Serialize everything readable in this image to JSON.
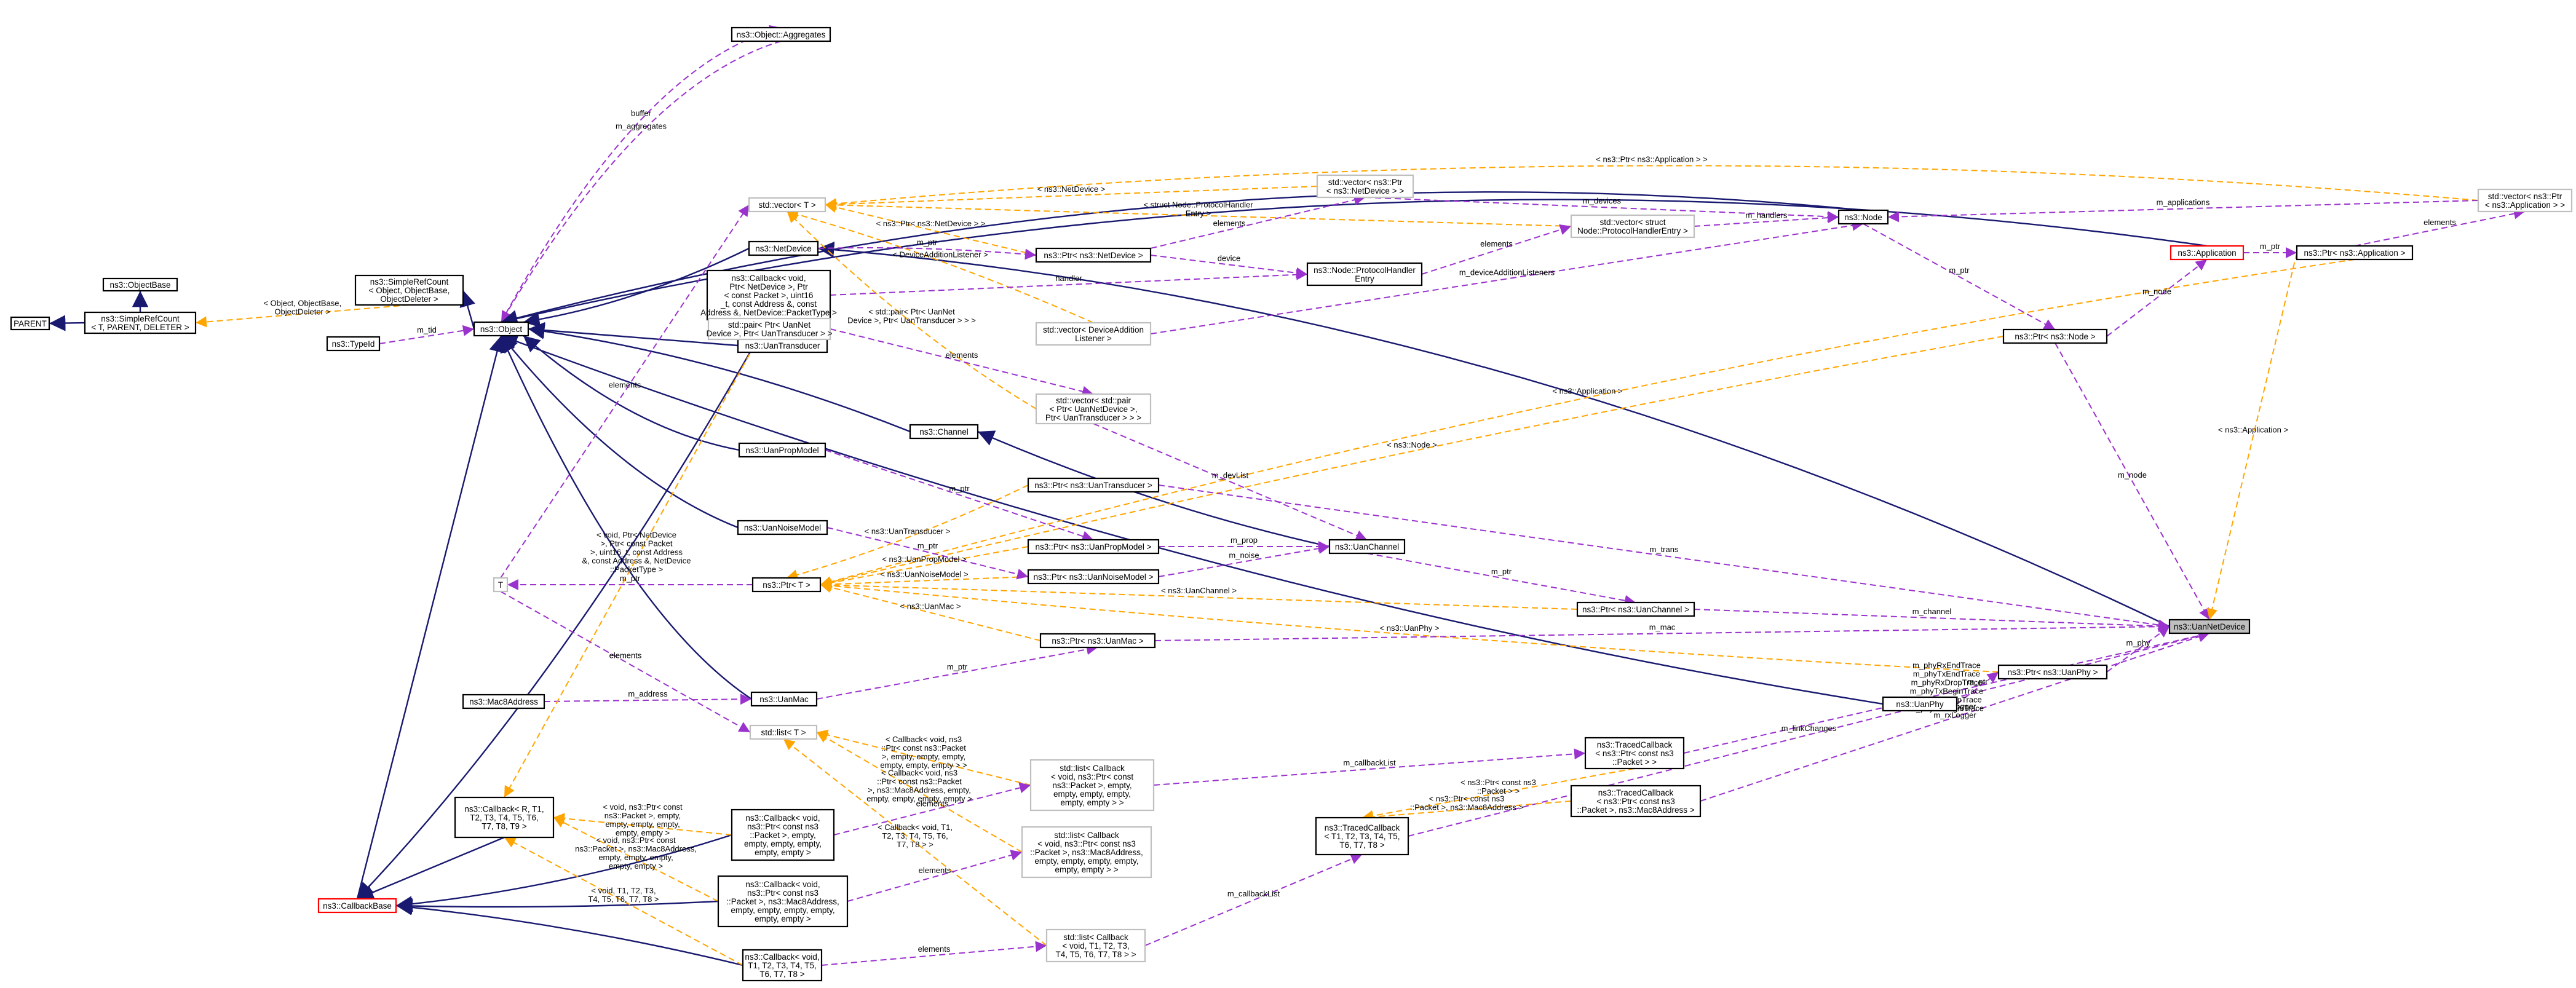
{
  "nodes": {
    "parent": "PARENT",
    "objectbase": "ns3::ObjectBase",
    "srcount_t": [
      "ns3::SimpleRefCount",
      "< T, PARENT, DELETER >"
    ],
    "srcount_obj": [
      "ns3::SimpleRefCount",
      "< Object, ObjectBase,",
      "ObjectDeleter >"
    ],
    "object": "ns3::Object",
    "typeid": "ns3::TypeId",
    "aggregates": "ns3::Object::Aggregates",
    "netdevice": "ns3::NetDevice",
    "cb_rx": [
      "ns3::Callback< void,",
      "Ptr< NetDevice >, Ptr",
      "< const Packet >, uint16",
      "_t, const Address &, const",
      "Address &, NetDevice::PacketType >"
    ],
    "uantransducer": "ns3::UanTransducer",
    "uanchannel_cls": "ns3::Channel",
    "uanprop": "ns3::UanPropModel",
    "uannoise": "ns3::UanNoiseModel",
    "t": "T",
    "ptr_t": "ns3::Ptr< T >",
    "uanmac": "ns3::UanMac",
    "macaddr": "ns3::Mac8Address",
    "list_t": "std::list< T >",
    "vector_t": "std::vector< T >",
    "ptr_netdev": "ns3::Ptr< ns3::NetDevice >",
    "vec_ptr_netdev": [
      "std::vector< ns3::Ptr",
      "< ns3::NetDevice > >"
    ],
    "vec_handler": [
      "std::vector< struct",
      "Node::ProtocolHandlerEntry >"
    ],
    "handler_entry": [
      "ns3::Node::ProtocolHandler",
      "Entry"
    ],
    "vec_listener": [
      "std::vector< DeviceAddition",
      "Listener >"
    ],
    "pair_dev": [
      "std::pair< Ptr< UanNet",
      "Device >, Ptr< UanTransducer > >"
    ],
    "vec_pair": [
      "std::vector< std::pair",
      "< Ptr< UanNetDevice >,",
      "Ptr< UanTransducer > > >"
    ],
    "ptr_transducer": "ns3::Ptr< ns3::UanTransducer >",
    "ptr_prop": "ns3::Ptr< ns3::UanPropModel >",
    "ptr_noise": "ns3::Ptr< ns3::UanNoiseModel >",
    "uanchannel": "ns3::UanChannel",
    "ptr_uanchannel": "ns3::Ptr< ns3::UanChannel >",
    "ptr_uanmac": "ns3::Ptr< ns3::UanMac >",
    "node": "ns3::Node",
    "application": "ns3::Application",
    "ptr_app": "ns3::Ptr< ns3::Application >",
    "vec_ptr_app": [
      "std::vector< ns3::Ptr",
      "< ns3::Application > >"
    ],
    "ptr_node": "ns3::Ptr< ns3::Node >",
    "uannetdevice": "ns3::UanNetDevice",
    "ptr_uanphy": "ns3::Ptr< ns3::UanPhy >",
    "uanphy": "ns3::UanPhy",
    "traced_pkt": [
      "ns3::TracedCallback",
      "< ns3::Ptr< const ns3",
      "::Packet > >"
    ],
    "traced_pkt_mac": [
      "ns3::TracedCallback",
      "< ns3::Ptr< const ns3",
      "::Packet >, ns3::Mac8Address >"
    ],
    "traced_t": [
      "ns3::TracedCallback",
      "< T1, T2, T3, T4, T5,",
      "T6, T7, T8 >"
    ],
    "cb_r": [
      "ns3::Callback< R, T1,",
      "T2, T3, T4, T5, T6,",
      "T7, T8, T9 >"
    ],
    "callbackbase": "ns3::CallbackBase",
    "list_cb_pkt": [
      "std::list< Callback",
      "< void, ns3::Ptr< const",
      "ns3::Packet >, empty,",
      "empty, empty, empty,",
      "empty, empty > >"
    ],
    "list_cb_mac": [
      "std::list< Callback",
      "< void, ns3::Ptr< const ns3",
      "::Packet >, ns3::Mac8Address,",
      "empty, empty, empty, empty,",
      "empty, empty > >"
    ],
    "list_cb_t": [
      "std::list< Callback",
      "< void, T1, T2, T3,",
      "T4, T5, T6, T7, T8 > >"
    ],
    "cb_void_pkt": [
      "ns3::Callback< void,",
      "ns3::Ptr< const ns3",
      "::Packet >, empty,",
      "empty, empty, empty,",
      "empty, empty >"
    ],
    "cb_void_mac": [
      "ns3::Callback< void,",
      "ns3::Ptr< const ns3",
      "::Packet >, ns3::Mac8Address,",
      "empty, empty, empty, empty,",
      "empty, empty >"
    ],
    "cb_void_t": [
      "ns3::Callback< void,",
      "T1, T2, T3, T4, T5,",
      "T6, T7, T8 >"
    ]
  },
  "edge_labels": {
    "buffer": "buffer",
    "m_aggregates": "m_aggregates",
    "m_tid": "m_tid",
    "elements_vec": "elements",
    "srcount_tpl": [
      "< Object, ObjectBase,",
      "ObjectDeleter >"
    ],
    "cb_rx_tpl": [
      "< void, Ptr< NetDevice",
      ">, Ptr< const Packet",
      ">, uint16_t, const Address",
      "&, const Address &, NetDevice",
      "::PacketType >"
    ],
    "elements_prop": "elements",
    "m_ptr_netdev": "m_ptr",
    "ptr_netdev_tpl": "< ns3::Ptr< ns3::NetDevice > >",
    "handler_tpl": [
      "< struct Node::ProtocolHandler",
      "Entry >"
    ],
    "listener_tpl": "< DeviceAdditionListener >",
    "netdev_tpl": "< ns3::NetDevice >",
    "pair_tpl": [
      "< std::pair< Ptr< UanNet",
      "Device >, Ptr< UanTransducer > > >"
    ],
    "elements_netdev": "elements",
    "device": "device",
    "handler": "handler",
    "elements_handler": "elements",
    "m_ptr_trans": "m_ptr",
    "m_devList": "m_devList",
    "transducer_tpl": "< ns3::UanTransducer >",
    "m_ptr_prop": "m_ptr",
    "m_prop": "m_prop",
    "prop_tpl": "< ns3::UanPropModel >",
    "m_ptr_noise": "m_ptr",
    "m_noise": "m_noise",
    "noise_tpl": "< ns3::UanNoiseModel >",
    "m_ptr_chan": "m_ptr",
    "chan_tpl": "< ns3::UanChannel >",
    "m_ptr_t": "m_ptr",
    "mac_tpl": "< ns3::UanMac >",
    "m_ptr_mac": "m_ptr",
    "m_address": "m_address",
    "phy_tpl": "< ns3::UanPhy >",
    "elements_list": "elements",
    "m_devices": "m_devices",
    "m_handlers": "m_handlers",
    "m_deviceAdditionListeners": "m_deviceAdditionListeners",
    "m_applications": "m_applications",
    "app_vec_tpl": "< ns3::Ptr< ns3::Application > >",
    "elements_app": "elements",
    "m_ptr_app": "m_ptr",
    "m_node_app": "m_node",
    "m_ptr_node": "m_ptr",
    "node_tpl": "< ns3::Node >",
    "m_node_dev": "m_node",
    "m_trans": "m_trans",
    "m_channel": "m_channel",
    "m_mac": "m_mac",
    "m_phy": "m_phy",
    "m_ptr_phy": "m_ptr",
    "phy_traces": [
      "m_phyRxEndTrace",
      "m_phyTxEndTrace",
      "m_phyRxDropTrace",
      "m_phyTxBeginTrace",
      "m_phyTxDropTrace",
      "m_phyRxBeginTrace"
    ],
    "loggers": [
      "m_txLogger",
      "m_rxLogger"
    ],
    "m_linkChanges": "m_linkChanges",
    "app_tpl": "< ns3::Application >",
    "m_callbackList_pkt": "m_callbackList",
    "m_callbackList_t": "m_callbackList",
    "traced_pkt_tpl": [
      "< ns3::Ptr< const ns3",
      "::Packet > >"
    ],
    "traced_mac_tpl": [
      "< ns3::Ptr< const ns3",
      "::Packet >, ns3::Mac8Address >"
    ],
    "list_pkt_tpl": [
      "< Callback< void, ns3",
      "::Ptr< const ns3::Packet",
      ">, empty, empty, empty,",
      "empty, empty, empty > >"
    ],
    "list_mac_tpl": [
      "< Callback< void, ns3",
      "::Ptr< const ns3::Packet",
      ">, ns3::Mac8Address, empty,",
      "empty, empty, empty, empty >"
    ],
    "list_t_tpl": [
      "< Callback< void, T1,",
      "T2, T3, T4, T5, T6,",
      "T7, T8 > >"
    ],
    "elements_cb1": "elements",
    "elements_cb2": "elements",
    "elements_cb3": "elements",
    "cb_pkt_tpl": [
      "< void, ns3::Ptr< const",
      "ns3::Packet >, empty,",
      "empty, empty, empty,",
      "empty, empty >"
    ],
    "cb_mac_tpl": [
      "< void, ns3::Ptr< const",
      "ns3::Packet >, ns3::Mac8Address,",
      "empty, empty, empty,",
      "empty, empty >"
    ],
    "cb_t_tpl": [
      "< void, T1, T2, T3,",
      "T4, T5, T6, T7, T8 >"
    ]
  }
}
